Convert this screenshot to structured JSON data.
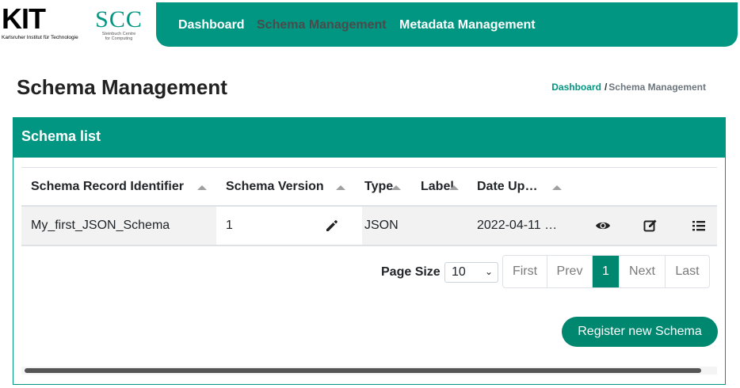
{
  "brand": {
    "kit_logo_text": "KIT",
    "kit_subtitle": "Karlsruher Institut für Technologie",
    "scc_logo_text": "SCC",
    "scc_subtitle_1": "Steinbuch Centre",
    "scc_subtitle_2": "for Computing"
  },
  "nav": {
    "dashboard": "Dashboard",
    "schema_management": "Schema Management",
    "metadata_management": "Metadata Management"
  },
  "page": {
    "title": "Schema Management",
    "breadcrumb_link": "Dashboard",
    "breadcrumb_separator": "/",
    "breadcrumb_current": "Schema Management"
  },
  "card": {
    "title": "Schema list"
  },
  "table": {
    "columns": [
      "Schema Record Identifier",
      "Schema Version",
      "Type",
      "Label",
      "Date Up…"
    ],
    "rows": [
      {
        "identifier": "My_first_JSON_Schema",
        "version": "1",
        "type": "JSON",
        "label": "",
        "date": "2022-04-11 …"
      }
    ]
  },
  "pagination": {
    "page_size_label": "Page Size",
    "page_size_value": "10",
    "first": "First",
    "prev": "Prev",
    "current": "1",
    "next": "Next",
    "last": "Last"
  },
  "actions": {
    "register_label": "Register new Schema"
  },
  "colors": {
    "primary": "#009682",
    "button": "#00876f"
  }
}
